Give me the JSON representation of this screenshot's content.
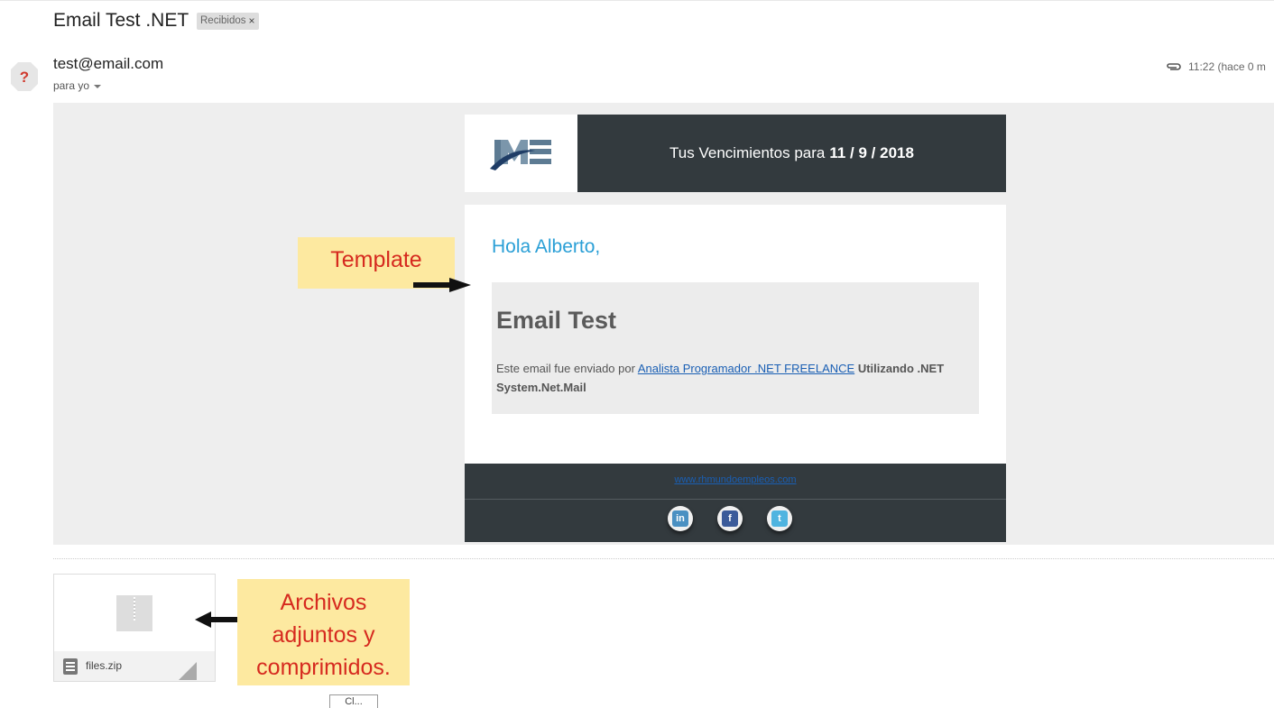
{
  "email": {
    "subject": "Email Test .NET",
    "label": "Recibidos",
    "label_remove": "×",
    "avatar_glyph": "?",
    "sender": "test@email.com",
    "recipient": "para yo",
    "timestamp": "11:22 (hace 0 m"
  },
  "template": {
    "header_title_prefix": "Tus Vencimientos para",
    "header_title_date": "11 / 9 / 2018",
    "greeting": "Hola Alberto,",
    "heading": "Email Test",
    "body_text": "Este email fue enviado por",
    "body_link": "Analista Programador .NET FREELANCE",
    "body_strong": "Utilizando .NET System.Net.Mail",
    "footer_link": "www.rhmundoempleos.com",
    "social": [
      {
        "name": "linkedin",
        "glyph": "in",
        "color": "#4a90c2"
      },
      {
        "name": "facebook",
        "glyph": "f",
        "color": "#3b5b9a"
      },
      {
        "name": "twitter",
        "glyph": "t",
        "color": "#4fb4e0"
      }
    ]
  },
  "annotations": {
    "template_note": "Template",
    "attachments_note_lines": [
      "Archivos",
      "adjuntos y",
      "comprimidos."
    ]
  },
  "attachment": {
    "file_name": "files.zip"
  },
  "partial_button": {
    "label": "Cl..."
  }
}
